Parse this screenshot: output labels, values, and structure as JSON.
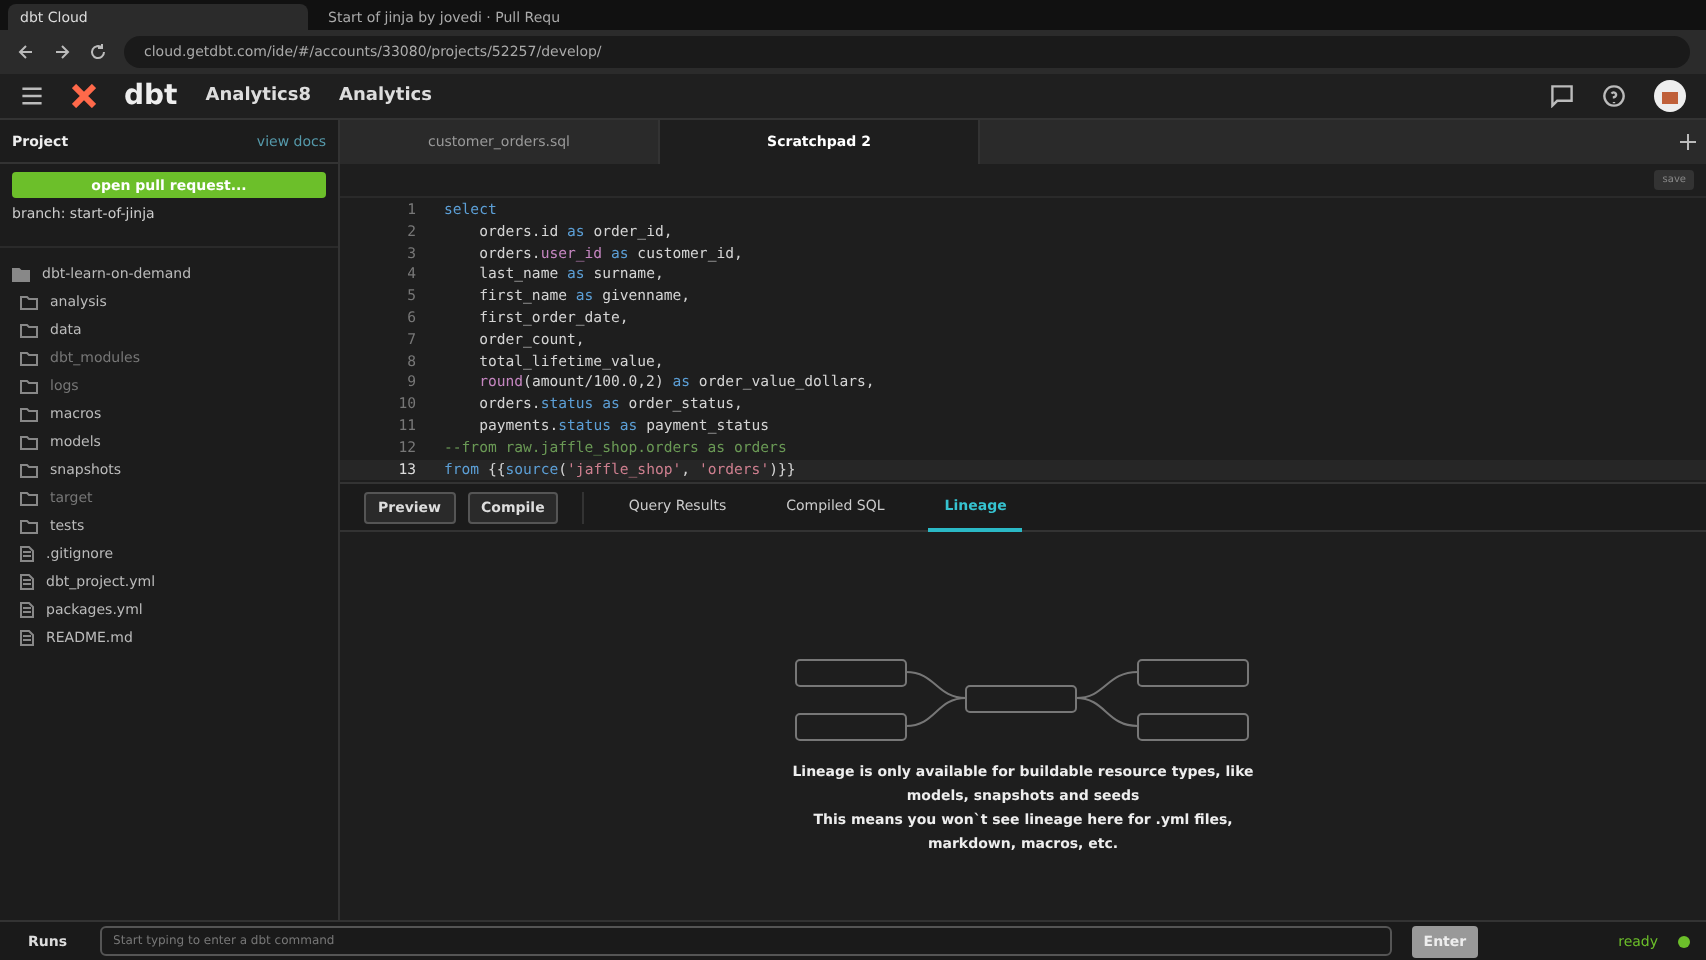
{
  "browser": {
    "tabs": [
      {
        "title": "dbt Cloud",
        "selected": true
      },
      {
        "title": "Start of jinja by jovedi · Pull Requ",
        "selected": false
      }
    ],
    "url": "cloud.getdbt.com/ide/#/accounts/33080/projects/52257/develop/"
  },
  "header": {
    "logo": "dbt",
    "account": "Analytics8",
    "project": "Analytics"
  },
  "sidebar": {
    "title": "Project",
    "view_docs": "view docs",
    "pull_request_button": "open pull request...",
    "branch": "branch: start-of-jinja",
    "tree": [
      {
        "name": "dbt-learn-on-demand",
        "kind": "folder",
        "expanded": true,
        "children": [
          {
            "name": "analysis",
            "kind": "folder",
            "ignored": false
          },
          {
            "name": "data",
            "kind": "folder",
            "ignored": false
          },
          {
            "name": "dbt_modules",
            "kind": "folder",
            "ignored": true
          },
          {
            "name": "logs",
            "kind": "folder",
            "ignored": true
          },
          {
            "name": "macros",
            "kind": "folder",
            "ignored": false
          },
          {
            "name": "models",
            "kind": "folder",
            "ignored": false
          },
          {
            "name": "snapshots",
            "kind": "folder",
            "ignored": false
          },
          {
            "name": "target",
            "kind": "folder",
            "ignored": true
          },
          {
            "name": "tests",
            "kind": "folder",
            "ignored": false
          },
          {
            "name": ".gitignore",
            "kind": "file",
            "ignored": false
          },
          {
            "name": "dbt_project.yml",
            "kind": "file",
            "ignored": false
          },
          {
            "name": "packages.yml",
            "kind": "file",
            "ignored": false
          },
          {
            "name": "README.md",
            "kind": "file",
            "ignored": false
          }
        ]
      }
    ]
  },
  "editor_tabs": [
    {
      "label": "customer_orders.sql",
      "selected": false
    },
    {
      "label": "Scratchpad 2",
      "selected": true
    }
  ],
  "save_button": "save",
  "code": [
    {
      "n": "1",
      "active": false,
      "tokens": [
        {
          "t": "select",
          "kind": "keyword"
        }
      ]
    },
    {
      "n": "2",
      "active": false,
      "tokens": [
        {
          "t": "    orders.id ",
          "kind": "plain"
        },
        {
          "t": "as",
          "kind": "keyword"
        },
        {
          "t": " order_id,",
          "kind": "plain"
        }
      ]
    },
    {
      "n": "3",
      "active": false,
      "tokens": [
        {
          "t": "    orders.",
          "kind": "plain"
        },
        {
          "t": "user_id",
          "kind": "function"
        },
        {
          "t": " as",
          "kind": "keyword"
        },
        {
          "t": " customer_id,",
          "kind": "plain"
        }
      ]
    },
    {
      "n": "4",
      "active": false,
      "tokens": [
        {
          "t": "    last_name ",
          "kind": "plain"
        },
        {
          "t": "as",
          "kind": "keyword"
        },
        {
          "t": " surname,",
          "kind": "plain"
        }
      ]
    },
    {
      "n": "5",
      "active": false,
      "tokens": [
        {
          "t": "    first_name ",
          "kind": "plain"
        },
        {
          "t": "as",
          "kind": "keyword"
        },
        {
          "t": " givenname,",
          "kind": "plain"
        }
      ]
    },
    {
      "n": "6",
      "active": false,
      "tokens": [
        {
          "t": "    first_order_date,",
          "kind": "plain"
        }
      ]
    },
    {
      "n": "7",
      "active": false,
      "tokens": [
        {
          "t": "    order_count,",
          "kind": "plain"
        }
      ]
    },
    {
      "n": "8",
      "active": false,
      "tokens": [
        {
          "t": "    total_lifetime_value,",
          "kind": "plain"
        }
      ]
    },
    {
      "n": "9",
      "active": false,
      "tokens": [
        {
          "t": "    round",
          "kind": "function"
        },
        {
          "t": "(amount/100.0,2) ",
          "kind": "plain"
        },
        {
          "t": "as",
          "kind": "keyword"
        },
        {
          "t": " order_value_dollars,",
          "kind": "plain"
        }
      ]
    },
    {
      "n": "10",
      "active": false,
      "tokens": [
        {
          "t": "    orders.",
          "kind": "plain"
        },
        {
          "t": "status as",
          "kind": "keyword"
        },
        {
          "t": " order_status,",
          "kind": "plain"
        }
      ]
    },
    {
      "n": "11",
      "active": false,
      "tokens": [
        {
          "t": "    payments.",
          "kind": "plain"
        },
        {
          "t": "status as",
          "kind": "keyword"
        },
        {
          "t": " payment_status",
          "kind": "plain"
        }
      ]
    },
    {
      "n": "12",
      "active": false,
      "tokens": [
        {
          "t": "--from raw.jaffle_shop.orders as orders",
          "kind": "comment"
        }
      ]
    },
    {
      "n": "13",
      "active": true,
      "tokens": [
        {
          "t": "from",
          "kind": "keyword"
        },
        {
          "t": " {{",
          "kind": "plain"
        },
        {
          "t": "source",
          "kind": "keyword"
        },
        {
          "t": "(",
          "kind": "plain"
        },
        {
          "t": "'jaffle_shop'",
          "kind": "string"
        },
        {
          "t": ", ",
          "kind": "plain"
        },
        {
          "t": "'orders'",
          "kind": "string"
        },
        {
          "t": ")}}",
          "kind": "plain"
        }
      ]
    }
  ],
  "toolbar": {
    "preview": "Preview",
    "compile": "Compile",
    "tabs": [
      {
        "label": "Query Results",
        "selected": false
      },
      {
        "label": "Compiled SQL",
        "selected": false
      },
      {
        "label": "Lineage",
        "selected": true
      }
    ]
  },
  "lineage": {
    "message_1": "Lineage is only available for buildable resource types, like models, snapshots and seeds",
    "message_2": "This means you won`t see lineage here for .yml files, markdown, macros, etc."
  },
  "command_bar": {
    "runs": "Runs",
    "placeholder": "Start typing to enter a dbt command",
    "enter": "Enter",
    "status": "ready"
  }
}
